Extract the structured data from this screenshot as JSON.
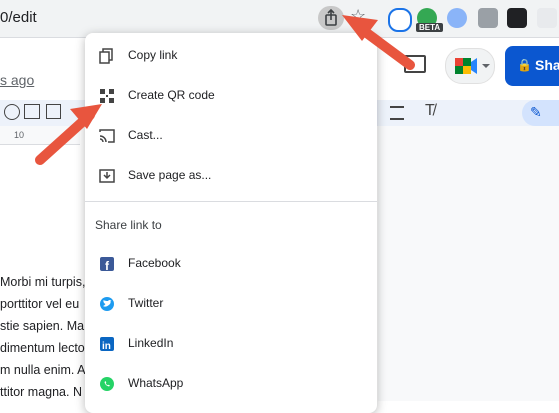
{
  "browser": {
    "url_fragment": "0/edit",
    "beta_badge": "BETA"
  },
  "docs": {
    "last_edit": "s ago",
    "share_label": "Sha",
    "ruler_tick": "10",
    "body_lines": [
      "Morbi mi turpis,",
      "porttitor vel eu",
      "stie sapien. Ma",
      "dimentum lecto",
      "m nulla enim. A",
      "ttitor magna. N"
    ]
  },
  "share_menu": {
    "items": [
      {
        "label": "Copy link",
        "icon": "copy-link-icon"
      },
      {
        "label": "Create QR code",
        "icon": "qr-code-icon"
      },
      {
        "label": "Cast...",
        "icon": "cast-icon"
      },
      {
        "label": "Save page as...",
        "icon": "save-page-icon"
      }
    ],
    "section_title": "Share link to",
    "share_targets": [
      {
        "label": "Facebook",
        "icon": "facebook-icon",
        "color": "#1877f2"
      },
      {
        "label": "Twitter",
        "icon": "twitter-icon",
        "color": "#1d9bf0"
      },
      {
        "label": "LinkedIn",
        "icon": "linkedin-icon",
        "color": "#0a66c2"
      },
      {
        "label": "WhatsApp",
        "icon": "whatsapp-icon",
        "color": "#25d366"
      }
    ]
  },
  "colors": {
    "arrow": "#e8553e",
    "share_button": "#0b57d0"
  }
}
